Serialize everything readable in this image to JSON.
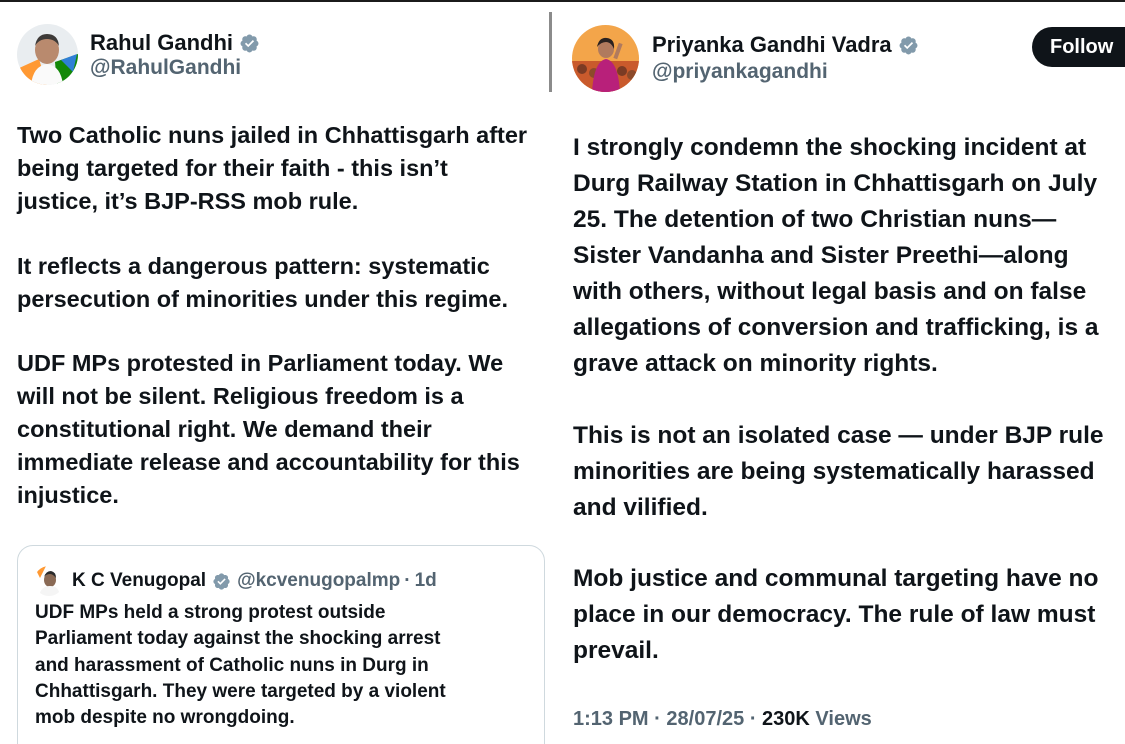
{
  "left_tweet": {
    "author_name": "Rahul Gandhi",
    "author_handle": "@RahulGandhi",
    "paragraphs": [
      "Two Catholic nuns jailed in Chhattisgarh after\nbeing targeted for their faith - this isn’t\njustice, it’s BJP-RSS mob rule.",
      "It reflects a dangerous pattern: systematic\npersecution of minorities under this regime.",
      "UDF MPs protested in Parliament today. We\nwill not be silent. Religious freedom is a\nconstitutional right. We demand their\nimmediate release and accountability for this\ninjustice."
    ],
    "quoted_tweet": {
      "author_name": "K C Venugopal",
      "author_handle": "@kcvenugopalmp",
      "separator": "·",
      "time_ago": "1d",
      "text": "UDF MPs held a strong protest outside\nParliament today against the shocking arrest\nand harassment of Catholic nuns in Durg in\nChhattisgarh. They were targeted by a violent\nmob despite no wrongdoing."
    }
  },
  "right_tweet": {
    "author_name": "Priyanka Gandhi Vadra",
    "author_handle": "@priyankagandhi",
    "follow_label": "Follow",
    "lines": [
      "I strongly condemn the shocking incident at",
      "Durg Railway Station in Chhattisgarh on July",
      "25. The detention of two Christian nuns—",
      "Sister Vandanha and Sister Preethi—along",
      "with others, without legal basis and on false",
      "allegations of conversion and trafficking, is a",
      "grave attack on minority rights.",
      "This is not an isolated case — under BJP rule",
      "minorities are being systematically harassed",
      "and vilified.",
      "Mob justice and communal targeting have no",
      "place in our democracy. The rule of law must",
      "prevail."
    ],
    "time": "1:13 PM",
    "date": "28/07/25",
    "views_count": "230K",
    "views_label": "Views",
    "separator": "·"
  },
  "colors": {
    "verified_badge": "#829aab",
    "text_primary": "#0f1419",
    "text_secondary": "#536471",
    "follow_button_bg": "#0f1419"
  },
  "icons": {
    "verified": "verified-badge-icon"
  }
}
